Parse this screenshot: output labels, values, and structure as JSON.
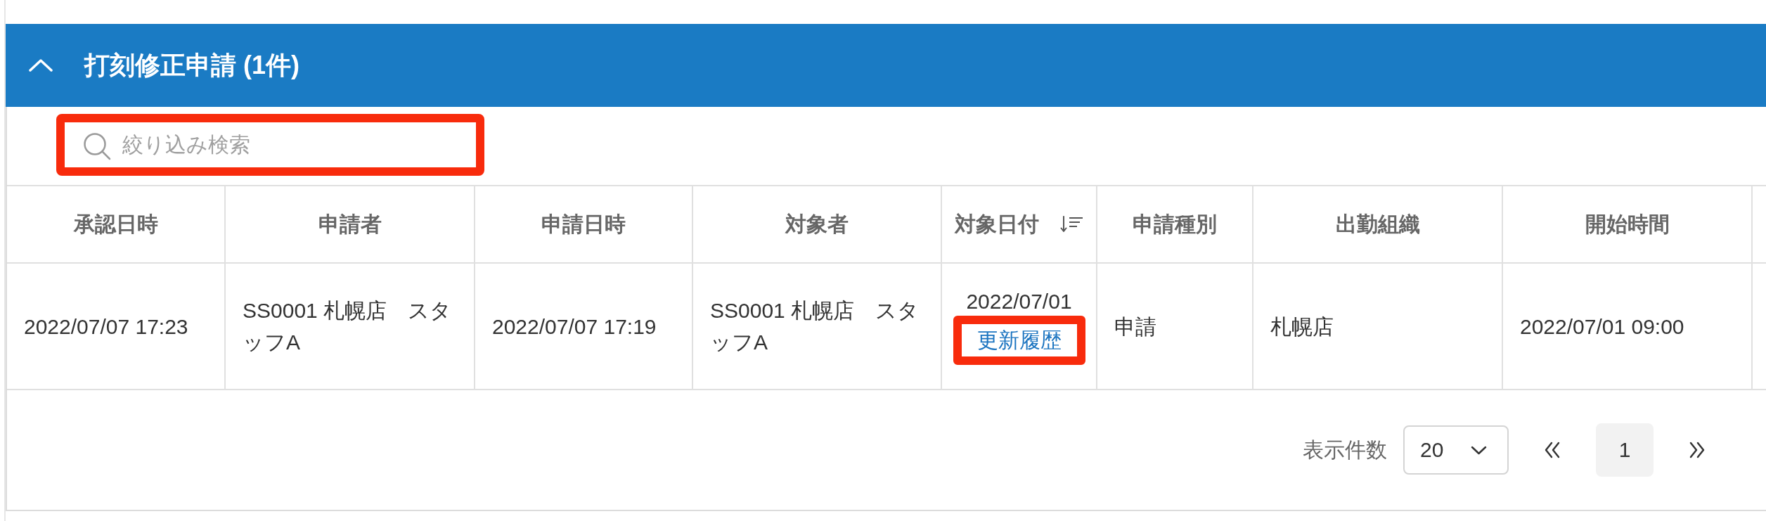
{
  "panel": {
    "title": "打刻修正申請 (1件)",
    "expanded": true
  },
  "search": {
    "placeholder": "絞り込み検索",
    "highlighted": true
  },
  "table": {
    "columns": [
      {
        "label": "承認日時",
        "sorted": false
      },
      {
        "label": "申請者",
        "sorted": false
      },
      {
        "label": "申請日時",
        "sorted": false
      },
      {
        "label": "対象者",
        "sorted": false
      },
      {
        "label": "対象日付",
        "sorted": true
      },
      {
        "label": "申請種別",
        "sorted": false
      },
      {
        "label": "出勤組織",
        "sorted": false
      },
      {
        "label": "開始時間",
        "sorted": false
      }
    ],
    "rows": [
      {
        "cells": [
          {
            "kind": "text",
            "text": "2022/07/07 17:23"
          },
          {
            "kind": "text",
            "text": "SS0001 札幌店　スタッフA"
          },
          {
            "kind": "text",
            "text": "2022/07/07 17:19"
          },
          {
            "kind": "text",
            "text": "SS0001 札幌店　スタッフA"
          },
          {
            "kind": "date-link",
            "text": "2022/07/01",
            "link": {
              "label": "更新履歴",
              "highlighted": true
            }
          },
          {
            "kind": "text",
            "text": "申請"
          },
          {
            "kind": "text",
            "text": "札幌店"
          },
          {
            "kind": "text",
            "text": "2022/07/01 09:00"
          }
        ]
      }
    ]
  },
  "pagination": {
    "page_size_label": "表示件数",
    "page_size": "20",
    "pages": [
      {
        "label": "1",
        "selected": true
      }
    ]
  }
}
